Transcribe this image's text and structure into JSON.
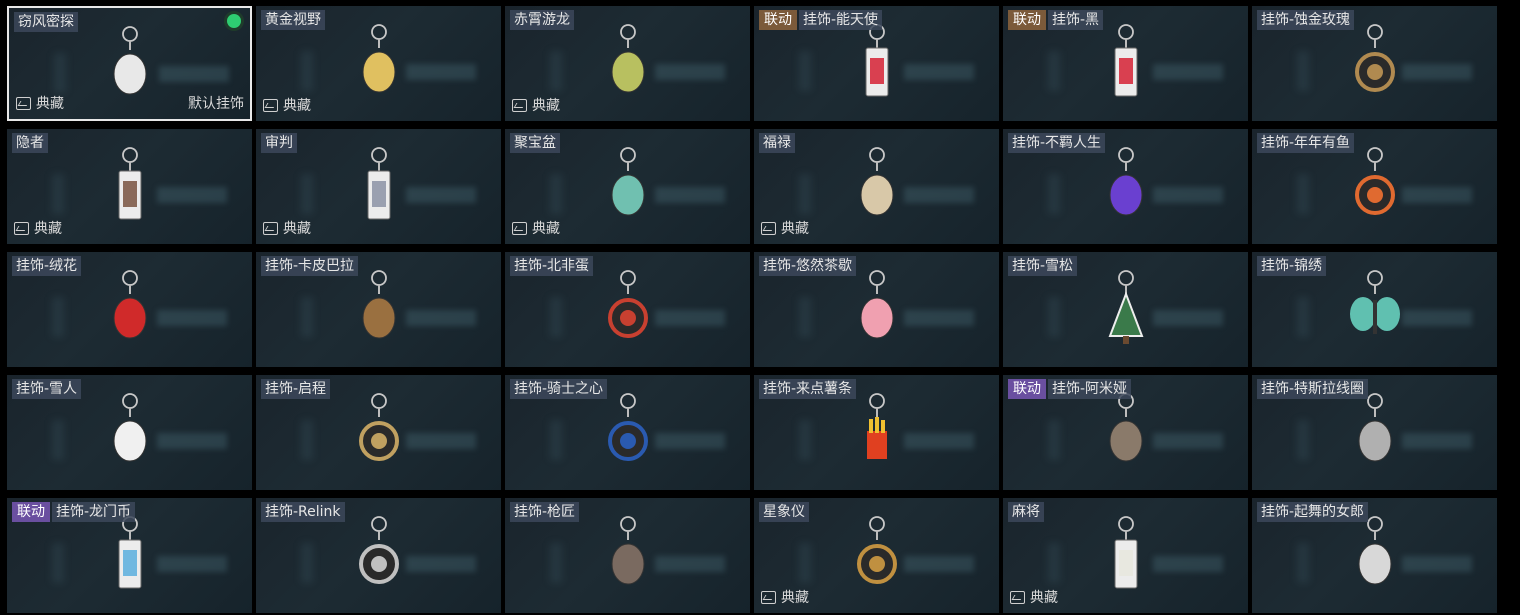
{
  "tiles": [
    {
      "name": "窃风密探",
      "badge": "",
      "badge_color": "",
      "collect": "典藏",
      "default": "默认挂饰",
      "selected": true,
      "color": "#e8e8e8",
      "icon": "rabbit-charm-icon"
    },
    {
      "name": "黄金视野",
      "badge": "",
      "badge_color": "",
      "collect": "典藏",
      "default": "",
      "selected": false,
      "color": "#e0c060",
      "icon": "chibi-figure-icon"
    },
    {
      "name": "赤霄游龙",
      "badge": "",
      "badge_color": "",
      "collect": "典藏",
      "default": "",
      "selected": false,
      "color": "#b8c060",
      "icon": "chibi-figure-icon"
    },
    {
      "name": "挂饰-能天使",
      "badge": "联动",
      "badge_color": "gold",
      "collect": "",
      "default": "",
      "selected": false,
      "color": "#d94050",
      "icon": "card-charm-icon"
    },
    {
      "name": "挂饰-黑",
      "badge": "联动",
      "badge_color": "gold",
      "collect": "",
      "default": "",
      "selected": false,
      "color": "#d94050",
      "icon": "card-charm-icon"
    },
    {
      "name": "挂饰-蚀金玫瑰",
      "badge": "",
      "badge_color": "",
      "collect": "",
      "default": "",
      "selected": false,
      "color": "#b08a50",
      "icon": "rose-emblem-icon"
    },
    {
      "name": "隐者",
      "badge": "",
      "badge_color": "",
      "collect": "典藏",
      "default": "",
      "selected": false,
      "color": "#8a6a5a",
      "icon": "tarot-card-icon"
    },
    {
      "name": "审判",
      "badge": "",
      "badge_color": "",
      "collect": "典藏",
      "default": "",
      "selected": false,
      "color": "#9aa0b0",
      "icon": "tarot-card-icon"
    },
    {
      "name": "聚宝盆",
      "badge": "",
      "badge_color": "",
      "collect": "典藏",
      "default": "",
      "selected": false,
      "color": "#70c0b0",
      "icon": "treasure-bowl-icon"
    },
    {
      "name": "福禄",
      "badge": "",
      "badge_color": "",
      "collect": "典藏",
      "default": "",
      "selected": false,
      "color": "#d8c8a8",
      "icon": "gourd-icon"
    },
    {
      "name": "挂饰-不羁人生",
      "badge": "",
      "badge_color": "",
      "collect": "",
      "default": "",
      "selected": false,
      "color": "#6a40d0",
      "icon": "sneaker-icon"
    },
    {
      "name": "挂饰-年年有鱼",
      "badge": "",
      "badge_color": "",
      "collect": "",
      "default": "",
      "selected": false,
      "color": "#e06a30",
      "icon": "fish-icon"
    },
    {
      "name": "挂饰-绒花",
      "badge": "",
      "badge_color": "",
      "collect": "",
      "default": "",
      "selected": false,
      "color": "#d02a2a",
      "icon": "flower-icon"
    },
    {
      "name": "挂饰-卡皮巴拉",
      "badge": "",
      "badge_color": "",
      "collect": "",
      "default": "",
      "selected": false,
      "color": "#9a7040",
      "icon": "capybara-icon"
    },
    {
      "name": "挂饰-北非蛋",
      "badge": "",
      "badge_color": "",
      "collect": "",
      "default": "",
      "selected": false,
      "color": "#c84030",
      "icon": "egg-dish-icon"
    },
    {
      "name": "挂饰-悠然茶歇",
      "badge": "",
      "badge_color": "",
      "collect": "",
      "default": "",
      "selected": false,
      "color": "#f0a0b0",
      "icon": "cupcake-icon"
    },
    {
      "name": "挂饰-雪松",
      "badge": "",
      "badge_color": "",
      "collect": "",
      "default": "",
      "selected": false,
      "color": "#3a7a4a",
      "icon": "tree-icon"
    },
    {
      "name": "挂饰-锦绣",
      "badge": "",
      "badge_color": "",
      "collect": "",
      "default": "",
      "selected": false,
      "color": "#60c0b0",
      "icon": "butterfly-icon"
    },
    {
      "name": "挂饰-雪人",
      "badge": "",
      "badge_color": "",
      "collect": "",
      "default": "",
      "selected": false,
      "color": "#f0f0f0",
      "icon": "snowman-icon"
    },
    {
      "name": "挂饰-启程",
      "badge": "",
      "badge_color": "",
      "collect": "",
      "default": "",
      "selected": false,
      "color": "#c0a060",
      "icon": "compass-badge-icon"
    },
    {
      "name": "挂饰-骑士之心",
      "badge": "",
      "badge_color": "",
      "collect": "",
      "default": "",
      "selected": false,
      "color": "#2a5ab0",
      "icon": "shield-badge-icon"
    },
    {
      "name": "挂饰-来点薯条",
      "badge": "",
      "badge_color": "",
      "collect": "",
      "default": "",
      "selected": false,
      "color": "#e04020",
      "icon": "fries-icon"
    },
    {
      "name": "挂饰-阿米娅",
      "badge": "联动",
      "badge_color": "purple",
      "collect": "",
      "default": "",
      "selected": false,
      "color": "#8a7a6a",
      "icon": "rabbit-ears-icon"
    },
    {
      "name": "挂饰-特斯拉线圈",
      "badge": "",
      "badge_color": "",
      "collect": "",
      "default": "",
      "selected": false,
      "color": "#b0b0b0",
      "icon": "tesla-coil-icon"
    },
    {
      "name": "挂饰-龙门币",
      "badge": "联动",
      "badge_color": "purple",
      "collect": "",
      "default": "",
      "selected": false,
      "color": "#70b8e0",
      "icon": "card-charm-icon"
    },
    {
      "name": "挂饰-Relink",
      "badge": "",
      "badge_color": "",
      "collect": "",
      "default": "",
      "selected": false,
      "color": "#c0c0c0",
      "icon": "knot-emblem-icon"
    },
    {
      "name": "挂饰-枪匠",
      "badge": "",
      "badge_color": "",
      "collect": "",
      "default": "",
      "selected": false,
      "color": "#7a6a60",
      "icon": "gun-case-icon"
    },
    {
      "name": "星象仪",
      "badge": "",
      "badge_color": "",
      "collect": "典藏",
      "default": "",
      "selected": false,
      "color": "#c09040",
      "icon": "astrolabe-icon"
    },
    {
      "name": "麻将",
      "badge": "",
      "badge_color": "",
      "collect": "典藏",
      "default": "",
      "selected": false,
      "color": "#e8e8e0",
      "icon": "mahjong-tile-icon"
    },
    {
      "name": "挂饰-起舞的女郎",
      "badge": "",
      "badge_color": "",
      "collect": "",
      "default": "",
      "selected": false,
      "color": "#d8d8d8",
      "icon": "dancer-figure-icon"
    }
  ]
}
